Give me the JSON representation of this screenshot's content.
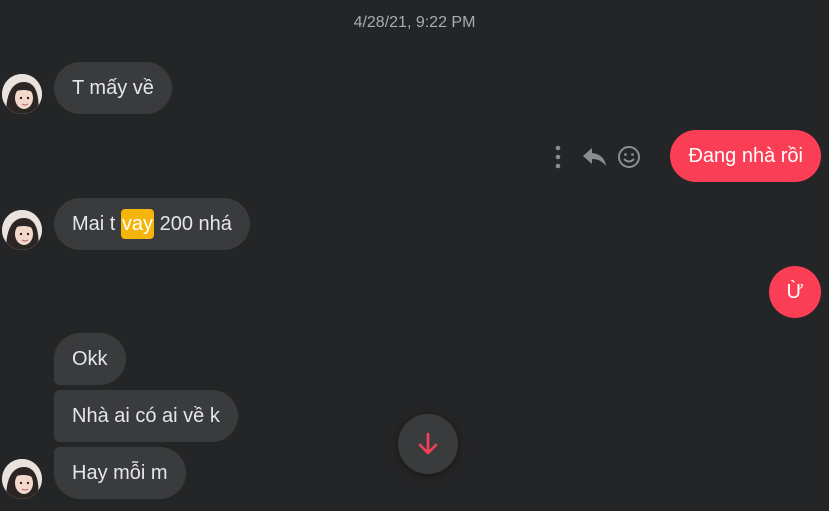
{
  "thread": {
    "timestamp": "4/28/21, 9:22 PM"
  },
  "messages": [
    {
      "from": "them",
      "text": "T mấy về"
    },
    {
      "from": "me",
      "text": "Đang nhà rồi"
    },
    {
      "from": "them",
      "parts": [
        "Mai t ",
        "vay",
        " 200 nhá"
      ]
    },
    {
      "from": "me",
      "text": "Ừ"
    },
    {
      "from": "them",
      "text": "Okk"
    },
    {
      "from": "them",
      "text": "Nhà ai có ai về k"
    },
    {
      "from": "them",
      "text": "Hay mỗi m"
    }
  ],
  "message_actions": {
    "icons": [
      "more-options-icon",
      "reply-icon",
      "react-smiley-icon"
    ]
  },
  "colors": {
    "background": "#242526",
    "incoming_bubble": "#3a3b3c",
    "outgoing_bubble": "#fa3e55",
    "highlight": "#f5b50c"
  }
}
